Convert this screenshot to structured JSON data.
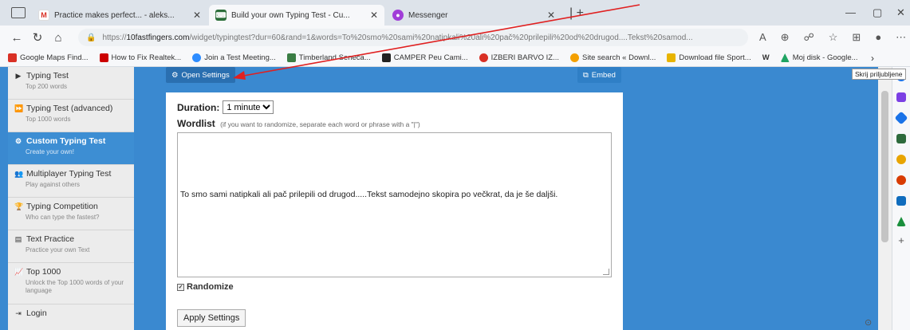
{
  "browser": {
    "tabs": [
      {
        "label": "Practice makes perfect... - aleks...",
        "favicon": "gmail-icon",
        "active": false
      },
      {
        "label": "Build your own Typing Test - Cu...",
        "favicon": "10ff-icon",
        "active": true
      },
      {
        "label": "Messenger",
        "favicon": "messenger-icon",
        "active": false
      }
    ],
    "url_prefix": "https://",
    "url_host": "10fastfingers.com",
    "url_rest": "/widget/typingtest?dur=60&rand=1&words=To%20smo%20sami%20natipkali%20ali%20pač%20prilepili%20od%20drugod....Tekst%20samod...",
    "bookmarks": [
      {
        "label": "Google Maps Find...",
        "color": "#d93025"
      },
      {
        "label": "How to Fix Realtek...",
        "color": "#cc0000"
      },
      {
        "label": "Join a Test Meeting...",
        "color": "#2d8cff"
      },
      {
        "label": "Timberland Seneca...",
        "color": "#3a7d44"
      },
      {
        "label": "CAMPER Peu Cami...",
        "color": "#222222"
      },
      {
        "label": "IZBERI BARVO IZ...",
        "color": "#f4b400"
      },
      {
        "label": "Site search « Downl...",
        "color": "#f4a000"
      },
      {
        "label": "Download file Sport...",
        "color": "#e8b400"
      },
      {
        "label": "Moj disk - Google...",
        "color": "#1fa463"
      }
    ],
    "tooltip": "Skrij priljubljene"
  },
  "nav": {
    "items": [
      {
        "label": "Typing Test",
        "sub": "Top 200 words",
        "icon": "play-icon",
        "active": false
      },
      {
        "label": "Typing Test (advanced)",
        "sub": "Top 1000 words",
        "icon": "fast-forward-icon",
        "active": false
      },
      {
        "label": "Custom Typing Test",
        "sub": "Create your own!",
        "icon": "cogs-icon",
        "active": true
      },
      {
        "label": "Multiplayer Typing Test",
        "sub": "Play against others",
        "icon": "users-icon",
        "active": false
      },
      {
        "label": "Typing Competition",
        "sub": "Who can type the fastest?",
        "icon": "trophy-icon",
        "active": false
      },
      {
        "label": "Text Practice",
        "sub": "Practice your own Text",
        "icon": "document-icon",
        "active": false
      },
      {
        "label": "Top 1000",
        "sub": "Unlock the Top 1000 words of your language",
        "icon": "chart-icon",
        "active": false
      },
      {
        "label": "Login",
        "sub": "",
        "icon": "login-icon",
        "active": false
      }
    ]
  },
  "toolbar": {
    "open_settings": "Open Settings",
    "embed": "Embed"
  },
  "settings": {
    "duration_label": "Duration:",
    "duration_value": "1 minute",
    "wordlist_label": "Wordlist",
    "wordlist_hint": "(if you want to randomize, separate each word or phrase with a \"|\")",
    "wordlist_text": "To smo sami natipkali ali pač prilepili od drugod.....Tekst samodejno skopira po večkrat, da je še daljši.",
    "randomize_label": "Randomize",
    "apply_label": "Apply Settings"
  }
}
